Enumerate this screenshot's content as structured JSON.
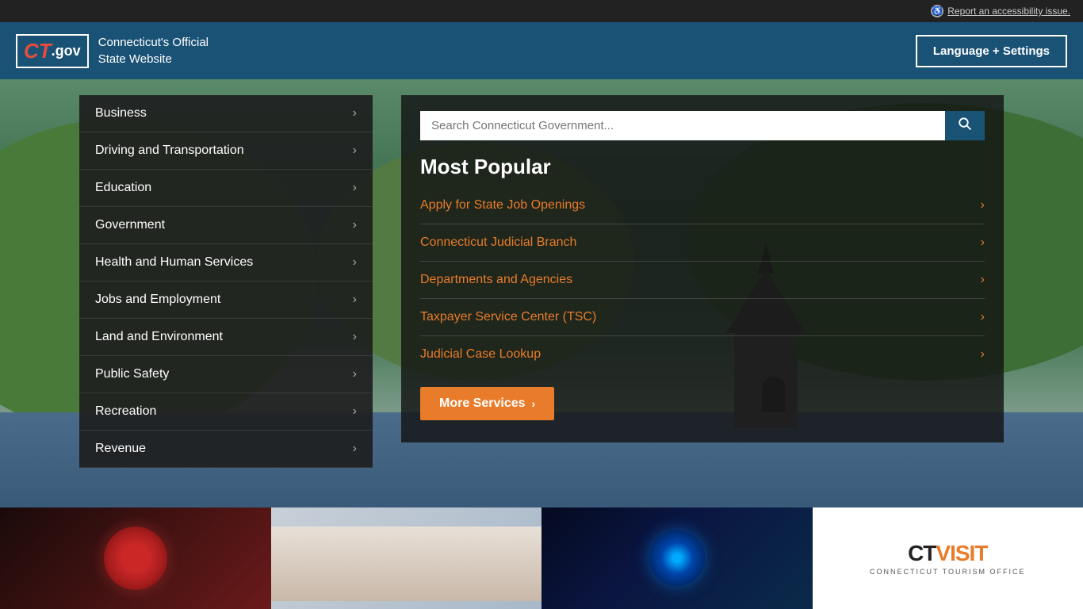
{
  "topbar": {
    "accessibility_label": "Report an accessibility issue."
  },
  "header": {
    "logo_ct": "CT",
    "logo_gov": ".gov",
    "site_name_line1": "Connecticut's Official",
    "site_name_line2": "State Website",
    "lang_button": "Language + Settings"
  },
  "nav": {
    "items": [
      {
        "label": "Business",
        "id": "business"
      },
      {
        "label": "Driving and Transportation",
        "id": "driving-transportation"
      },
      {
        "label": "Education",
        "id": "education"
      },
      {
        "label": "Government",
        "id": "government"
      },
      {
        "label": "Health and Human Services",
        "id": "health-human-services"
      },
      {
        "label": "Jobs and Employment",
        "id": "jobs-employment"
      },
      {
        "label": "Land and Environment",
        "id": "land-environment"
      },
      {
        "label": "Public Safety",
        "id": "public-safety"
      },
      {
        "label": "Recreation",
        "id": "recreation"
      },
      {
        "label": "Revenue",
        "id": "revenue"
      }
    ]
  },
  "search": {
    "placeholder": "Search Connecticut Government...",
    "button_icon": "🔍"
  },
  "most_popular": {
    "title": "Most Popular",
    "items": [
      {
        "label": "Apply for State Job Openings",
        "id": "state-jobs"
      },
      {
        "label": "Connecticut Judicial Branch",
        "id": "judicial-branch"
      },
      {
        "label": "Departments and Agencies",
        "id": "departments-agencies"
      },
      {
        "label": "Taxpayer Service Center (TSC)",
        "id": "taxpayer-service"
      },
      {
        "label": "Judicial Case Lookup",
        "id": "judicial-case-lookup"
      }
    ],
    "more_services_label": "More Services"
  }
}
